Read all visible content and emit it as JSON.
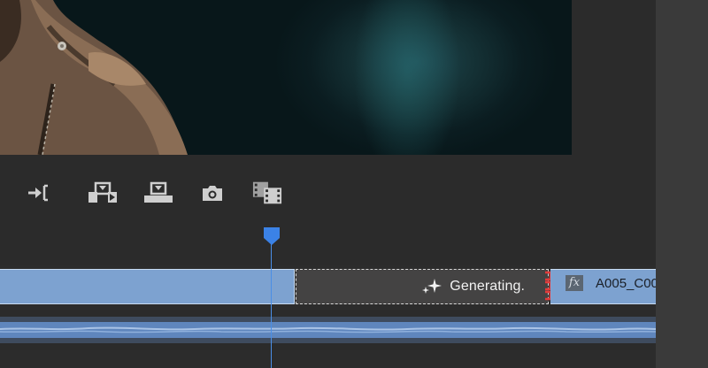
{
  "toolbar": {
    "buttons": [
      {
        "icon": "go-to-out-point-icon"
      },
      {
        "icon": "insert-icon"
      },
      {
        "icon": "overwrite-icon"
      },
      {
        "icon": "export-frame-camera-icon"
      },
      {
        "icon": "comparison-view-icon"
      }
    ]
  },
  "timeline": {
    "generating_clip": {
      "label": "Generating.",
      "icon": "sparkle-icon"
    },
    "next_clip": {
      "name": "A005_C00",
      "fx_badge": "fx"
    },
    "colors": {
      "clip": "#7da2d0",
      "playhead": "#3b82e6",
      "trim_handle": "#e23b3b",
      "generating_bg": "#444343"
    }
  }
}
